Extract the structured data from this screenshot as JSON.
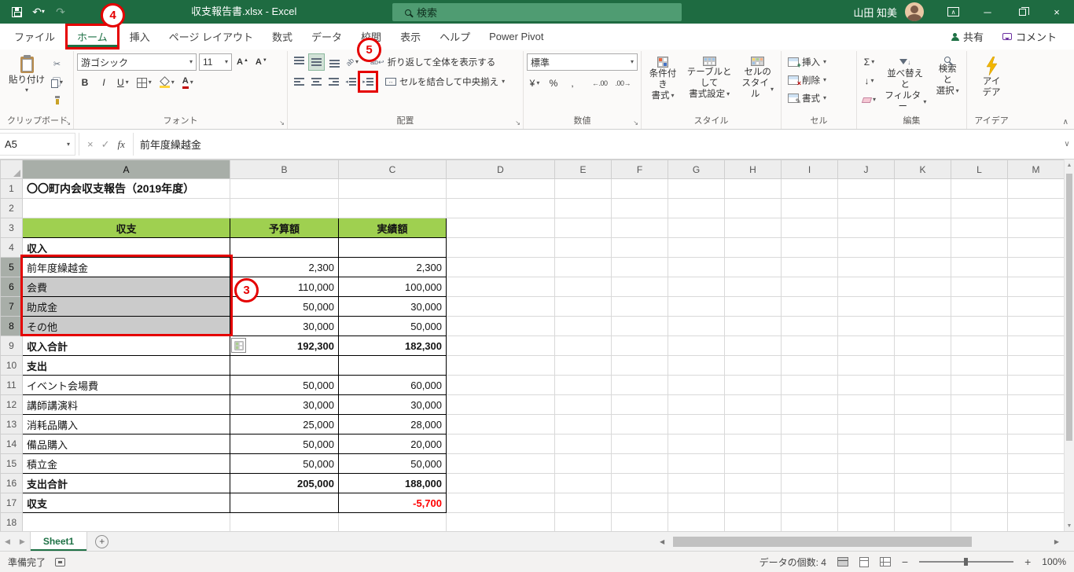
{
  "colors": {
    "titlebar_green": "#1E6B41",
    "excel_green": "#1E7145",
    "table_header_fill": "#9FD050",
    "selection_gray": "#CBCBCB",
    "annotation_red": "#E50000",
    "negative_red": "#FF0000"
  },
  "titlebar": {
    "filename": "収支報告書.xlsx -  Excel",
    "search_placeholder": "検索",
    "user_name": "山田 知美"
  },
  "tabs": {
    "file": "ファイル",
    "home": "ホーム",
    "insert": "挿入",
    "page_layout": "ページ レイアウト",
    "formulas": "数式",
    "data": "データ",
    "review": "校閲",
    "view": "表示",
    "help": "ヘルプ",
    "power_pivot": "Power Pivot",
    "share": "共有",
    "comments": "コメント"
  },
  "ribbon": {
    "clipboard": {
      "paste": "貼り付け",
      "group_label": "クリップボード"
    },
    "font": {
      "font_name": "游ゴシック",
      "font_size": "11",
      "group_label": "フォント"
    },
    "alignment": {
      "wrap_text": "折り返して全体を表示する",
      "merge_center": "セルを結合して中央揃え",
      "group_label": "配置"
    },
    "number": {
      "format": "標準",
      "group_label": "数値"
    },
    "styles": {
      "conditional_line1": "条件付き",
      "conditional_line2": "書式",
      "table_line1": "テーブルとして",
      "table_line2": "書式設定",
      "cellstyles_line1": "セルの",
      "cellstyles_line2": "スタイル",
      "group_label": "スタイル"
    },
    "cells": {
      "insert": "挿入",
      "delete": "削除",
      "format": "書式",
      "group_label": "セル"
    },
    "editing": {
      "sort_line1": "並べ替えと",
      "sort_line2": "フィルター",
      "find_line1": "検索と",
      "find_line2": "選択",
      "group_label": "編集"
    },
    "ideas": {
      "line1": "アイ",
      "line2": "デア",
      "group_label": "アイデア"
    }
  },
  "formula_bar": {
    "name_box": "A5",
    "fx_label": "fx",
    "content": "前年度繰越金"
  },
  "annotations": {
    "step3": "3",
    "step4": "4",
    "step5": "5"
  },
  "grid": {
    "col_headers": [
      "A",
      "B",
      "C",
      "D",
      "E",
      "F",
      "G",
      "H",
      "I",
      "J",
      "K",
      "L",
      "M"
    ],
    "selected_col": "A",
    "selected_rows": [
      5,
      6,
      7,
      8
    ],
    "rows": [
      {
        "n": 1,
        "a": "〇〇町内会収支報告（2019年度）",
        "b": "",
        "c": "",
        "style": "title"
      },
      {
        "n": 2,
        "a": "",
        "b": "",
        "c": "",
        "style": "outside"
      },
      {
        "n": 3,
        "a": "収支",
        "b": "予算額",
        "c": "実績額",
        "style": "theader"
      },
      {
        "n": 4,
        "a": "収入",
        "b": "",
        "c": "",
        "style": "section"
      },
      {
        "n": 5,
        "a": "前年度繰越金",
        "b": "2,300",
        "c": "2,300",
        "style": "data",
        "sel": "active"
      },
      {
        "n": 6,
        "a": "会費",
        "b": "110,000",
        "c": "100,000",
        "style": "data",
        "sel": "range"
      },
      {
        "n": 7,
        "a": "助成金",
        "b": "50,000",
        "c": "30,000",
        "style": "data",
        "sel": "range"
      },
      {
        "n": 8,
        "a": "その他",
        "b": "30,000",
        "c": "50,000",
        "style": "data",
        "sel": "range"
      },
      {
        "n": 9,
        "a": "収入合計",
        "b": "192,300",
        "c": "182,300",
        "style": "total"
      },
      {
        "n": 10,
        "a": "支出",
        "b": "",
        "c": "",
        "style": "section"
      },
      {
        "n": 11,
        "a": "イベント会場費",
        "b": "50,000",
        "c": "60,000",
        "style": "data"
      },
      {
        "n": 12,
        "a": "講師講演料",
        "b": "30,000",
        "c": "30,000",
        "style": "data"
      },
      {
        "n": 13,
        "a": "消耗品購入",
        "b": "25,000",
        "c": "28,000",
        "style": "data"
      },
      {
        "n": 14,
        "a": "備品購入",
        "b": "50,000",
        "c": "20,000",
        "style": "data"
      },
      {
        "n": 15,
        "a": "積立金",
        "b": "50,000",
        "c": "50,000",
        "style": "data"
      },
      {
        "n": 16,
        "a": "支出合計",
        "b": "205,000",
        "c": "188,000",
        "style": "total"
      },
      {
        "n": 17,
        "a": "収支",
        "b": "",
        "c": "-5,700",
        "style": "balance"
      },
      {
        "n": 18,
        "a": "",
        "b": "",
        "c": "",
        "style": "outside"
      }
    ]
  },
  "sheetbar": {
    "sheet_name": "Sheet1"
  },
  "statusbar": {
    "ready": "準備完了",
    "count": "データの個数: 4",
    "zoom": "100%"
  }
}
